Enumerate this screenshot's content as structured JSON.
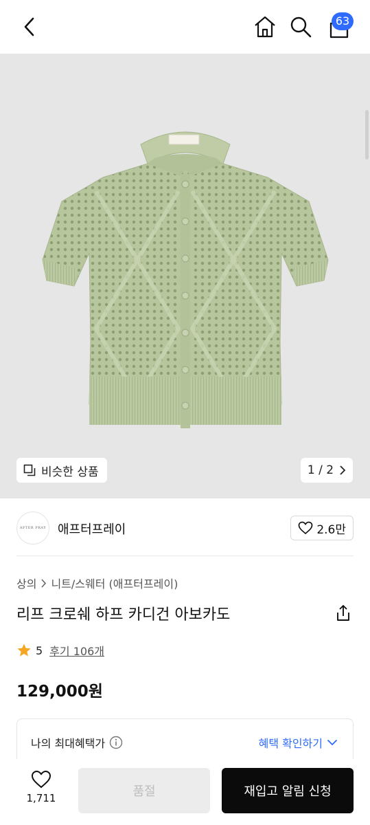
{
  "header": {
    "back_icon": "chevron-left-icon",
    "home_icon": "home-icon",
    "search_icon": "search-icon",
    "cart_icon": "shopping-bag-icon",
    "cart_count": "63",
    "badge_color": "#2f6bff"
  },
  "gallery": {
    "similar_label": "비슷한 상품",
    "similar_icon": "copy-squares-icon",
    "pager_text": "1 / 2",
    "pager_icon": "chevron-right-icon",
    "background_color": "#e6e6e6",
    "garment_color": "#b8c79e"
  },
  "brand": {
    "logo_text": "AFTER PRAY",
    "name": "애프터프레이",
    "like_count": "2.6만",
    "like_icon": "heart-outline-icon"
  },
  "product": {
    "breadcrumb": [
      "상의",
      "니트/스웨터 (애프터프레이)"
    ],
    "title": "리프 크로쉐 하프 카디건 아보카도",
    "share_icon": "share-icon",
    "rating": "5",
    "reviews_label": "후기 106개",
    "price": "129,000원"
  },
  "benefit": {
    "label": "나의 최대혜택가",
    "info_icon": "info-circle-icon",
    "link_label": "혜택 확인하기",
    "link_icon": "chevron-down-icon",
    "accent": "#2f6bff"
  },
  "footer": {
    "wish_count": "1,711",
    "wish_icon": "heart-outline-icon",
    "soldout_label": "품절",
    "restock_label": "재입고 알림 신청"
  }
}
